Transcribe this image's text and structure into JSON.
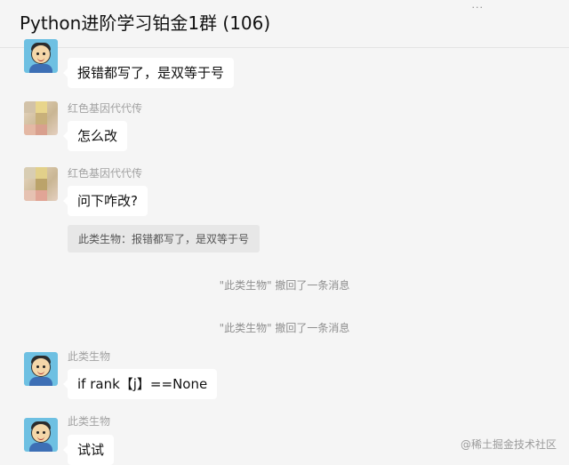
{
  "header": {
    "title": "Python进阶学习铂金1群 (106)",
    "more_icon": "more-dots-icon"
  },
  "messages": [
    {
      "sender": "",
      "text": "报错都写了，是双等于号",
      "avatar": "cartoon-boy"
    },
    {
      "sender": "红色基因代代传",
      "text": "怎么改",
      "avatar": "blurred"
    },
    {
      "sender": "红色基因代代传",
      "text": "问下咋改?",
      "avatar": "blurred",
      "quote": "此类生物：报错都写了，是双等于号"
    },
    {
      "system": "\"此类生物\" 撤回了一条消息"
    },
    {
      "system": "\"此类生物\" 撤回了一条消息"
    },
    {
      "sender": "此类生物",
      "text": "if rank【j】==None",
      "avatar": "cartoon-boy"
    },
    {
      "sender": "此类生物",
      "text": "试试",
      "avatar": "cartoon-boy"
    }
  ],
  "watermark": "@稀土掘金技术社区",
  "colors": {
    "background": "#f5f5f5",
    "bubble": "#ffffff",
    "quote_bg": "#e7e7e7",
    "sender_text": "#a2a2a2",
    "system_text": "#8f8f8f"
  }
}
